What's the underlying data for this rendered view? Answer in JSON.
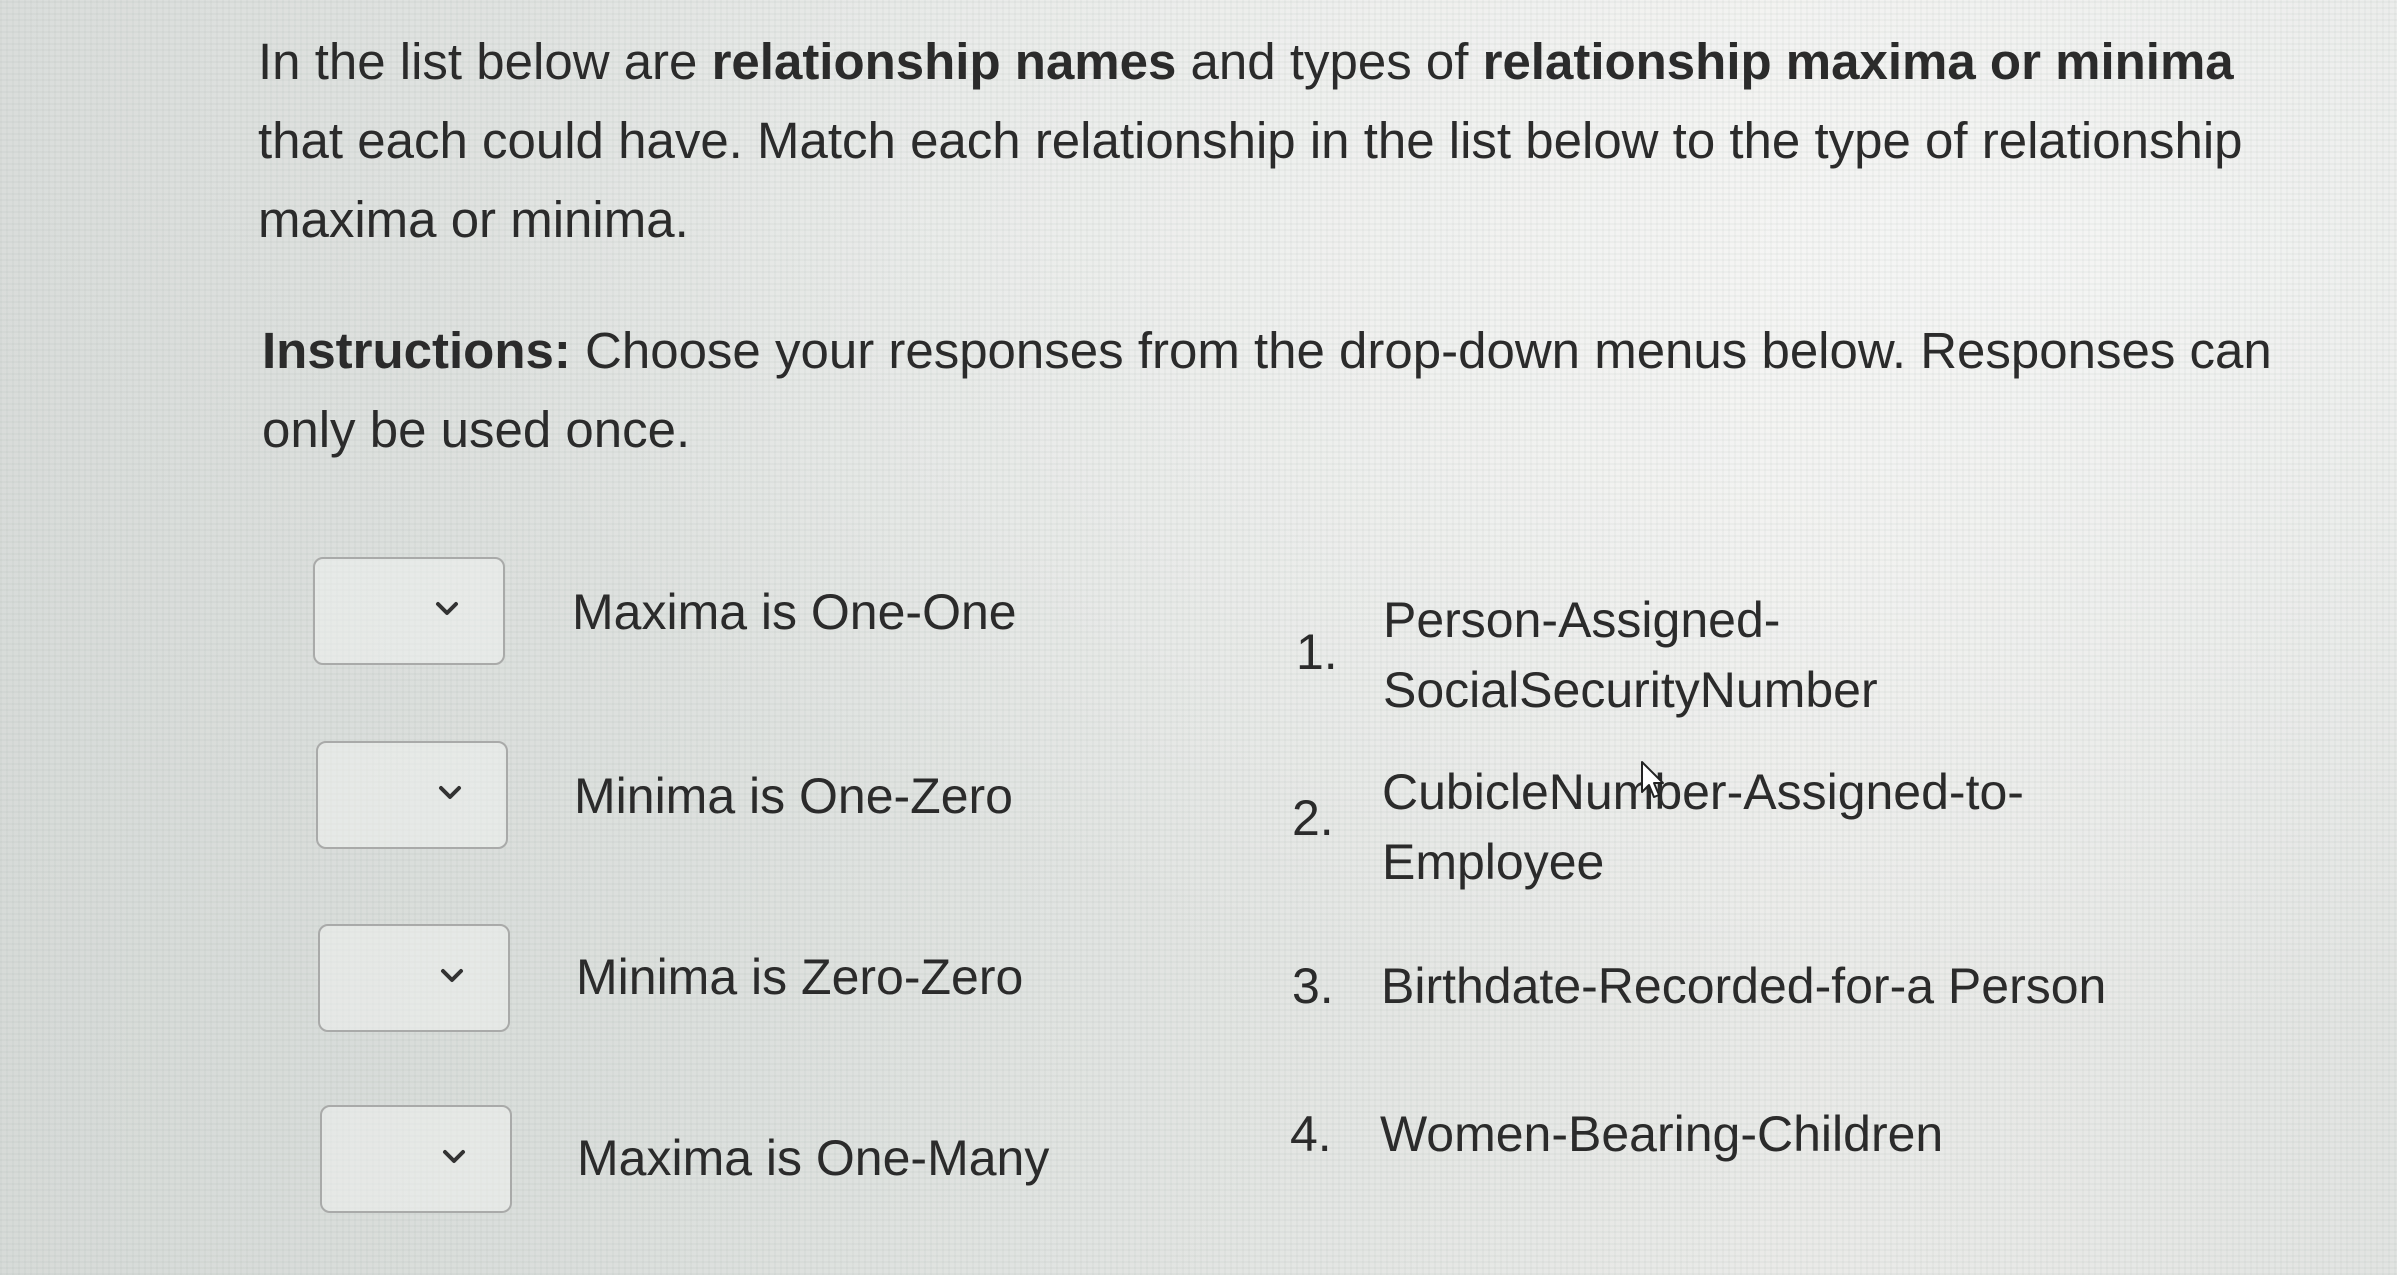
{
  "question": {
    "part1": "In the list below are ",
    "bold1": "relationship names",
    "part2": " and types of ",
    "bold2": "relationship maxima or minima",
    "part3": " that each could have. Match each relationship in the list below to the type of relationship maxima or minima."
  },
  "instructions": {
    "label": "Instructions:",
    "text": " Choose your responses from the drop-down menus below. Responses can only be used once."
  },
  "matches": [
    {
      "label": "Maxima is One-One",
      "selected": ""
    },
    {
      "label": "Minima is One-Zero",
      "selected": ""
    },
    {
      "label": "Minima is Zero-Zero",
      "selected": ""
    },
    {
      "label": "Maxima is One-Many",
      "selected": ""
    }
  ],
  "relationships": [
    {
      "num": "1.",
      "text": "Person-Assigned-SocialSecurityNumber"
    },
    {
      "num": "2.",
      "text": "CubicleNumber-Assigned-to-Employee"
    },
    {
      "num": "3.",
      "text": "Birthdate-Recorded-for-a Person"
    },
    {
      "num": "4.",
      "text": "Women-Bearing-Children"
    }
  ],
  "icons": {
    "dropdown": "chevron-down-icon",
    "cursor": "mouse-pointer-icon"
  },
  "colors": {
    "text": "#2b2b2b",
    "border": "#a9aaa9"
  }
}
